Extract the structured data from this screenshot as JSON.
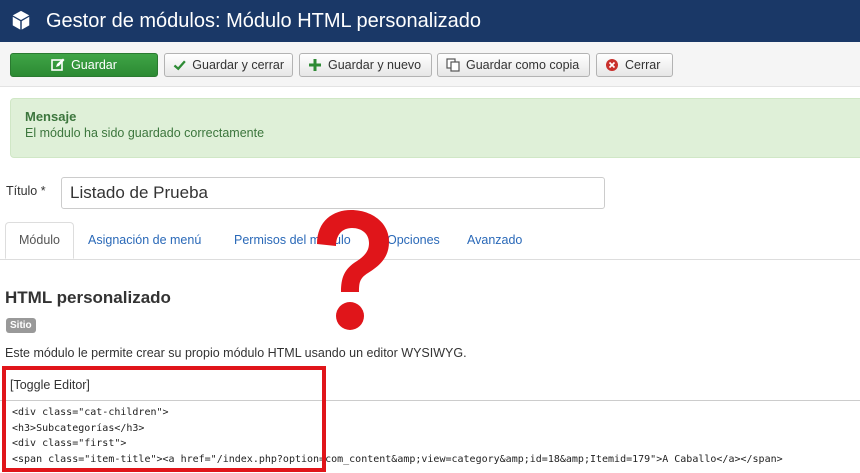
{
  "header": {
    "title": "Gestor de módulos: Módulo HTML personalizado",
    "icon": "cube-icon",
    "bg_color": "#1a3867"
  },
  "toolbar": {
    "save_label": "Guardar",
    "save_close_label": "Guardar y cerrar",
    "save_new_label": "Guardar y nuevo",
    "save_copy_label": "Guardar como copia",
    "close_label": "Cerrar"
  },
  "alert": {
    "heading": "Mensaje",
    "message": "El módulo ha sido guardado correctamente"
  },
  "form": {
    "title_label": "Título *",
    "title_value": "Listado de Prueba"
  },
  "tabs": [
    {
      "label": "Módulo",
      "active": true
    },
    {
      "label": "Asignación de menú",
      "active": false
    },
    {
      "label": "Permisos del módulo",
      "active": false
    },
    {
      "label": "Opciones",
      "active": false
    },
    {
      "label": "Avanzado",
      "active": false
    }
  ],
  "content": {
    "section_title": "HTML personalizado",
    "badge": "Sitio",
    "description": "Este módulo le permite crear su propio módulo HTML usando un editor WYSIWYG.",
    "toggle_editor": "[Toggle Editor]",
    "code_lines": [
      "<div class=\"cat-children\">",
      "<h3>Subcategorías</h3>",
      "<div class=\"first\">",
      "<span class=\"item-title\"><a href=\"/index.php?option=com_content&amp;view=category&amp;id=18&amp;Itemid=179\">A Caballo</a></span>"
    ]
  },
  "overlay": {
    "annotation_color": "#e0151a",
    "question_mark_icon": "question-mark-icon"
  }
}
